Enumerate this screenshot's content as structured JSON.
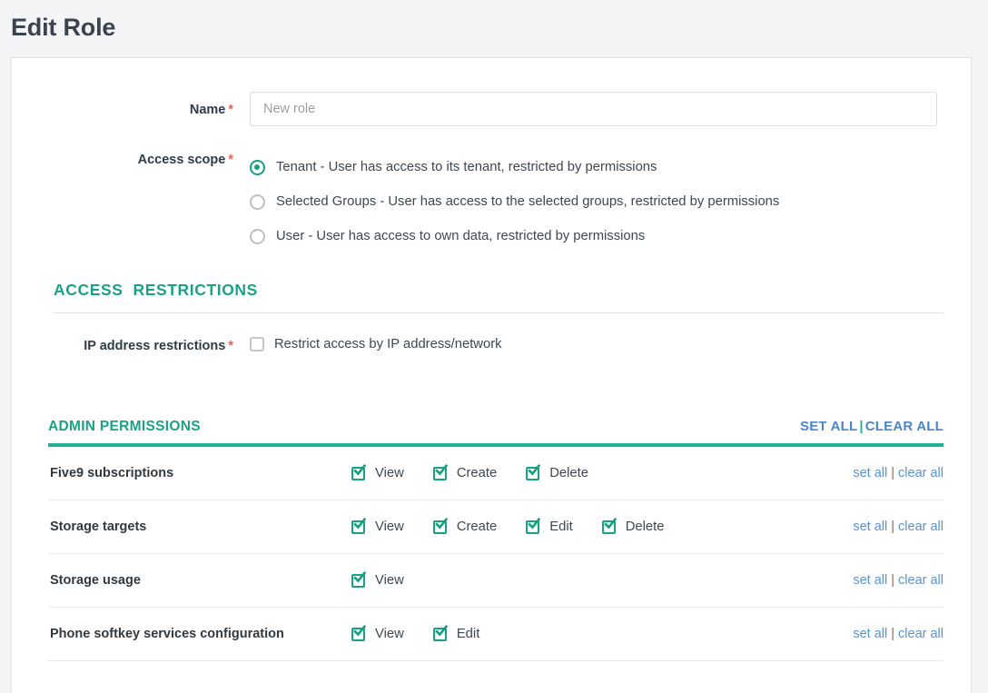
{
  "page": {
    "title": "Edit Role"
  },
  "form": {
    "name": {
      "label": "Name",
      "required_mark": "*",
      "value": "",
      "placeholder": "New role"
    },
    "access_scope": {
      "label": "Access scope",
      "required_mark": "*",
      "options": [
        {
          "label": "Tenant - User has access to its tenant, restricted by permissions",
          "selected": true
        },
        {
          "label": "Selected Groups - User has access to the selected groups, restricted by permissions",
          "selected": false
        },
        {
          "label": "User - User has access to own data, restricted by permissions",
          "selected": false
        }
      ]
    }
  },
  "access_restrictions": {
    "heading": "ACCESS  RESTRICTIONS",
    "ip": {
      "label": "IP address restrictions",
      "required_mark": "*",
      "checkbox_label": "Restrict access by IP address/network",
      "checked": false
    }
  },
  "admin_permissions": {
    "heading": "ADMIN PERMISSIONS",
    "set_all_label": "SET ALL",
    "separator": "|",
    "clear_all_label": "CLEAR ALL",
    "row_set_all_label": "set all",
    "row_separator": "|",
    "row_clear_all_label": "clear all",
    "rows": [
      {
        "name": "Five9 subscriptions",
        "permissions": [
          {
            "label": "View",
            "checked": true
          },
          {
            "label": "Create",
            "checked": true
          },
          {
            "label": "Delete",
            "checked": true
          }
        ]
      },
      {
        "name": "Storage targets",
        "permissions": [
          {
            "label": "View",
            "checked": true
          },
          {
            "label": "Create",
            "checked": true
          },
          {
            "label": "Edit",
            "checked": true
          },
          {
            "label": "Delete",
            "checked": true
          }
        ]
      },
      {
        "name": "Storage usage",
        "permissions": [
          {
            "label": "View",
            "checked": true
          }
        ]
      },
      {
        "name": "Phone softkey services configuration",
        "permissions": [
          {
            "label": "View",
            "checked": true
          },
          {
            "label": "Edit",
            "checked": true
          }
        ]
      }
    ]
  },
  "colors": {
    "accent_teal": "#1aa187",
    "underline_teal": "#22b196",
    "link_blue": "#5b93cf",
    "header_link_blue": "#4a86c8",
    "required_red": "#f25c4c",
    "title_gray": "#3a4450",
    "page_bg": "#f4f4f6"
  }
}
